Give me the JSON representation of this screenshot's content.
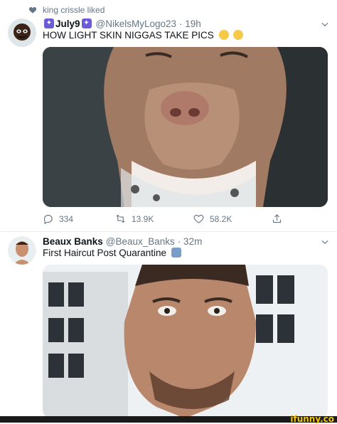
{
  "liked_by": "king crissle liked",
  "tweet1": {
    "display_name": "July9",
    "handle": "@NikelsMyLogo23",
    "time": "· 19h",
    "text": "HOW LIGHT SKIN NIGGAS TAKE PICS",
    "actions": {
      "replies": "334",
      "retweets": "13.9K",
      "likes": "58.2K"
    }
  },
  "tweet2": {
    "display_name": "Beaux Banks",
    "handle": "@Beaux_Banks",
    "time": "· 32m",
    "text": "First Haircut Post Quarantine"
  },
  "watermark": "ifunny.co",
  "icons": {
    "liked": "heart-icon",
    "more": "chevron-down-icon",
    "reply": "reply-icon",
    "retweet": "retweet-icon",
    "like": "like-icon",
    "share": "share-icon"
  },
  "colors": {
    "muted_text": "#657786",
    "badge": "#6b5bd6",
    "watermark": "#f4c40a"
  }
}
